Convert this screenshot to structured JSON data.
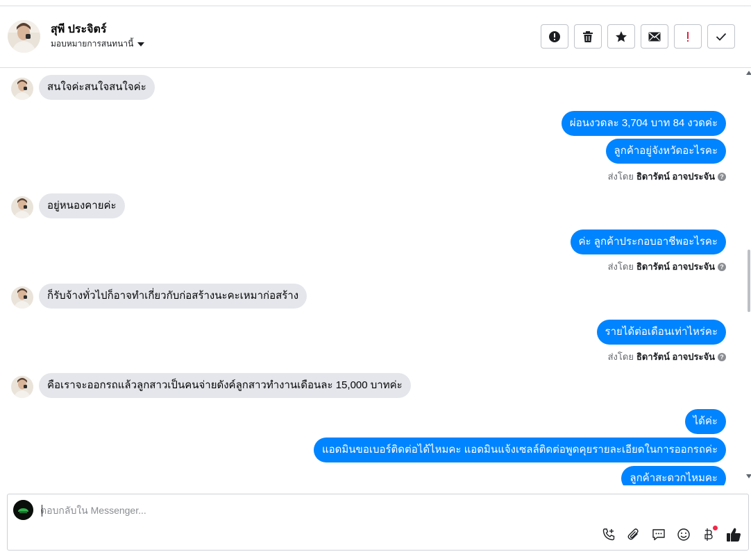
{
  "header": {
    "contact_name": "สุพี ประจิตร์",
    "assign_label": "มอบหมายการสนทนานี้",
    "icons": [
      "alert-circle-icon",
      "trash-icon",
      "star-icon",
      "envelope-icon",
      "exclamation-icon",
      "checkmark-icon"
    ]
  },
  "messages": [
    {
      "dir": "in",
      "text": "สนใจค่ะสนใจสนใจค่ะ"
    },
    {
      "dir": "out",
      "text": "ผ่อนงวดละ 3,704 บาท 84 งวดค่ะ"
    },
    {
      "dir": "out",
      "text": "ลูกค้าอยู่จังหวัดอะไรคะ"
    },
    {
      "dir": "in",
      "text": "อยู่หนองคายค่ะ"
    },
    {
      "dir": "out",
      "text": "ค่ะ ลูกค้าประกอบอาชีพอะไรคะ"
    },
    {
      "dir": "in",
      "text": "ก็รับจ้างทั่วไปก็อาจทำเกี่ยวกับก่อสร้างนะคะเหมาก่อสร้าง"
    },
    {
      "dir": "out",
      "text": "รายได้ต่อเดือนเท่าไหร่คะ"
    },
    {
      "dir": "in",
      "text": "คือเราจะออกรถแล้วลูกสาวเป็นคนจ่ายดังค์ลูกสาวทำงานเดือนละ 15,000 บาทค่ะ"
    },
    {
      "dir": "out",
      "text": "ได้ค่ะ"
    },
    {
      "dir": "out",
      "text": "แอดมินขอเบอร์ติดต่อได้ไหมคะ แอดมินแจ้งเซลล์ติดต่อพูดคุยรายละเอียดในการออกรถค่ะ"
    },
    {
      "dir": "out",
      "text": "ลูกค้าสะดวกไหมคะ"
    }
  ],
  "sent_by": {
    "prefix": "ส่งโดย",
    "agent": "ธิดารัตน์ อาจประจัน",
    "help": "?"
  },
  "composer": {
    "placeholder": "ตอบกลับใน Messenger...",
    "tools": [
      "phone-plus-icon",
      "paperclip-icon",
      "saved-reply-icon",
      "emoji-icon",
      "baht-icon",
      "like-icon"
    ]
  },
  "colors": {
    "outgoing_bubble": "#0084ff",
    "incoming_bubble": "#e4e6eb",
    "notification_dot": "#f02849"
  }
}
